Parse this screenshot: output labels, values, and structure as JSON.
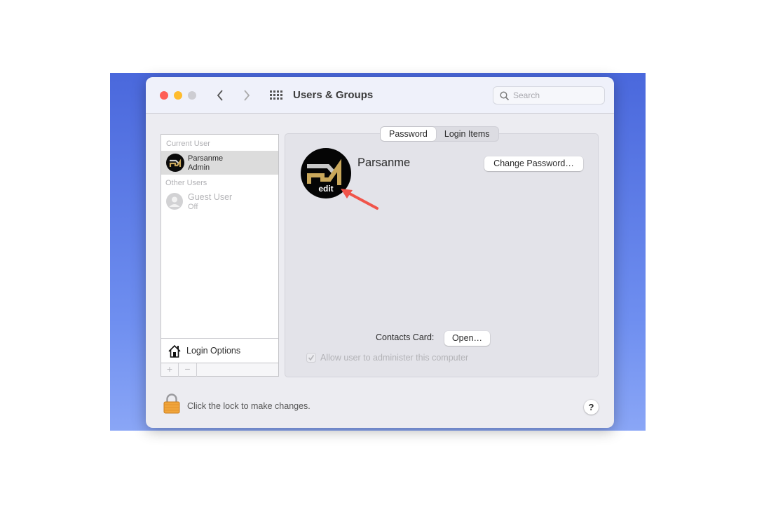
{
  "window": {
    "title": "Users & Groups",
    "search_placeholder": "Search"
  },
  "sidebar": {
    "current_user_label": "Current User",
    "current_user": {
      "name": "Parsanme",
      "role": "Admin"
    },
    "other_users_label": "Other Users",
    "other_users": [
      {
        "name": "Guest User",
        "status": "Off"
      }
    ],
    "login_options": "Login Options",
    "add_label": "+",
    "remove_label": "−"
  },
  "tabs": [
    {
      "label": "Password",
      "selected": true
    },
    {
      "label": "Login Items",
      "selected": false
    }
  ],
  "user_panel": {
    "name": "Parsanme",
    "avatar_edit_label": "edit",
    "avatar_logo_text": "PM",
    "change_password": "Change Password…",
    "contacts_card_label": "Contacts Card:",
    "open_button": "Open…",
    "allow_admin_label": "Allow user to administer this computer",
    "allow_admin_checked": true
  },
  "footer": {
    "lock_message": "Click the lock to make changes.",
    "help": "?"
  },
  "colors": {
    "close": "#fe5f57",
    "minimize": "#febc2e",
    "zoom_inactive": "#cdcdd2",
    "arrow": "#f0544a",
    "desktop": "#4a68dc"
  }
}
